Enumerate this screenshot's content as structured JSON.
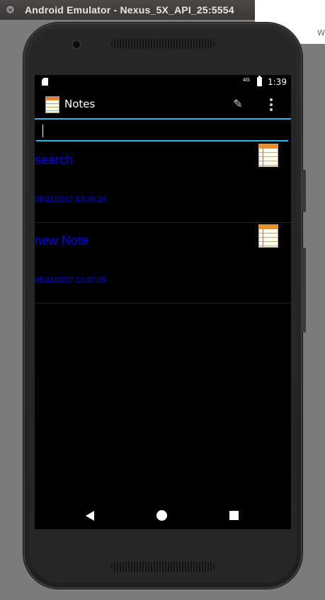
{
  "window": {
    "title": "Android Emulator - Nexus_5X_API_25:5554",
    "corner_text": "W"
  },
  "statusbar": {
    "network": "4G",
    "time": "1:39"
  },
  "appbar": {
    "title": "Notes"
  },
  "search": {
    "value": "",
    "placeholder": ""
  },
  "notes": [
    {
      "title": "search",
      "date": "05/21/2017 13:39:24"
    },
    {
      "title": "new Note",
      "date": "05/21/2017 13:37:39"
    }
  ],
  "colors": {
    "accent": "#33b5e5",
    "note_text": "#0000e8",
    "screen_bg": "#000000"
  },
  "icons": [
    "notepad-icon",
    "new-note-icon",
    "overflow-menu-icon",
    "back-icon",
    "home-icon",
    "recents-icon"
  ]
}
